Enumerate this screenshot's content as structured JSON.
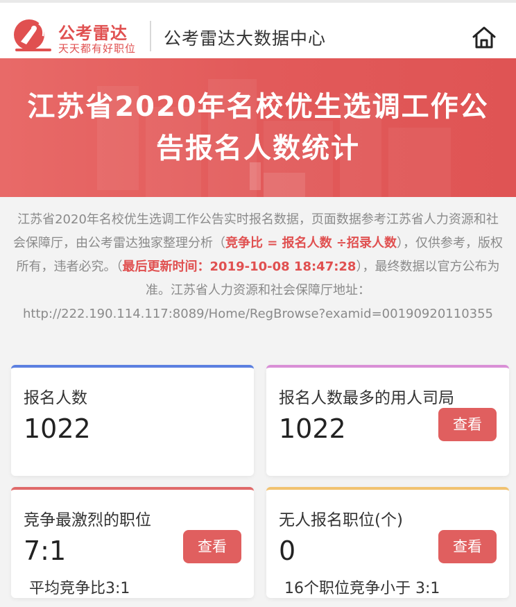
{
  "header": {
    "brand_name": "公考雷达",
    "brand_slogan": "天天都有好职位",
    "title": "公考雷达大数据中心",
    "home_icon": "home-icon"
  },
  "banner": {
    "title_line1": "江苏省2020年名校优生选调工作公",
    "title_line2": "告报名人数统计"
  },
  "description": {
    "part1": "江苏省2020年名校优生选调工作公告实时报名数据，页面数据参考江苏省人力资源和社会保障厅，由公考雷达独家整理分析（",
    "formula": "竞争比 = 报名人数 ÷招录人数",
    "part2": "），仅供参考，版权所有，违者必究。（",
    "updated": "最后更新时间：2019-10-08 18:47:28",
    "part3": "），最终数据以官方公布为准。江苏省人力资源和社会保障厅地址：",
    "url": "http://222.190.114.117:8089/Home/RegBrowse?examid=00190920110355"
  },
  "cards": [
    {
      "label": "报名人数",
      "value": "1022",
      "sub": "",
      "button": ""
    },
    {
      "label": "报名人数最多的用人司局",
      "value": "1022",
      "sub": "",
      "button": "查看"
    },
    {
      "label": "竞争最激烈的职位",
      "value": "7:1",
      "sub": "平均竞争比3:1",
      "button": "查看"
    },
    {
      "label": "无人报名职位(个)",
      "value": "0",
      "sub": "16个职位竞争小于 3:1",
      "button": "查看"
    }
  ],
  "colors": {
    "accent": "#e05050",
    "banner": "#e25a5a",
    "card_1_border": "#5b7fe0",
    "card_2_border": "#d98fd6",
    "card_3_border": "#e06a6a",
    "card_4_border": "#f1c270"
  }
}
